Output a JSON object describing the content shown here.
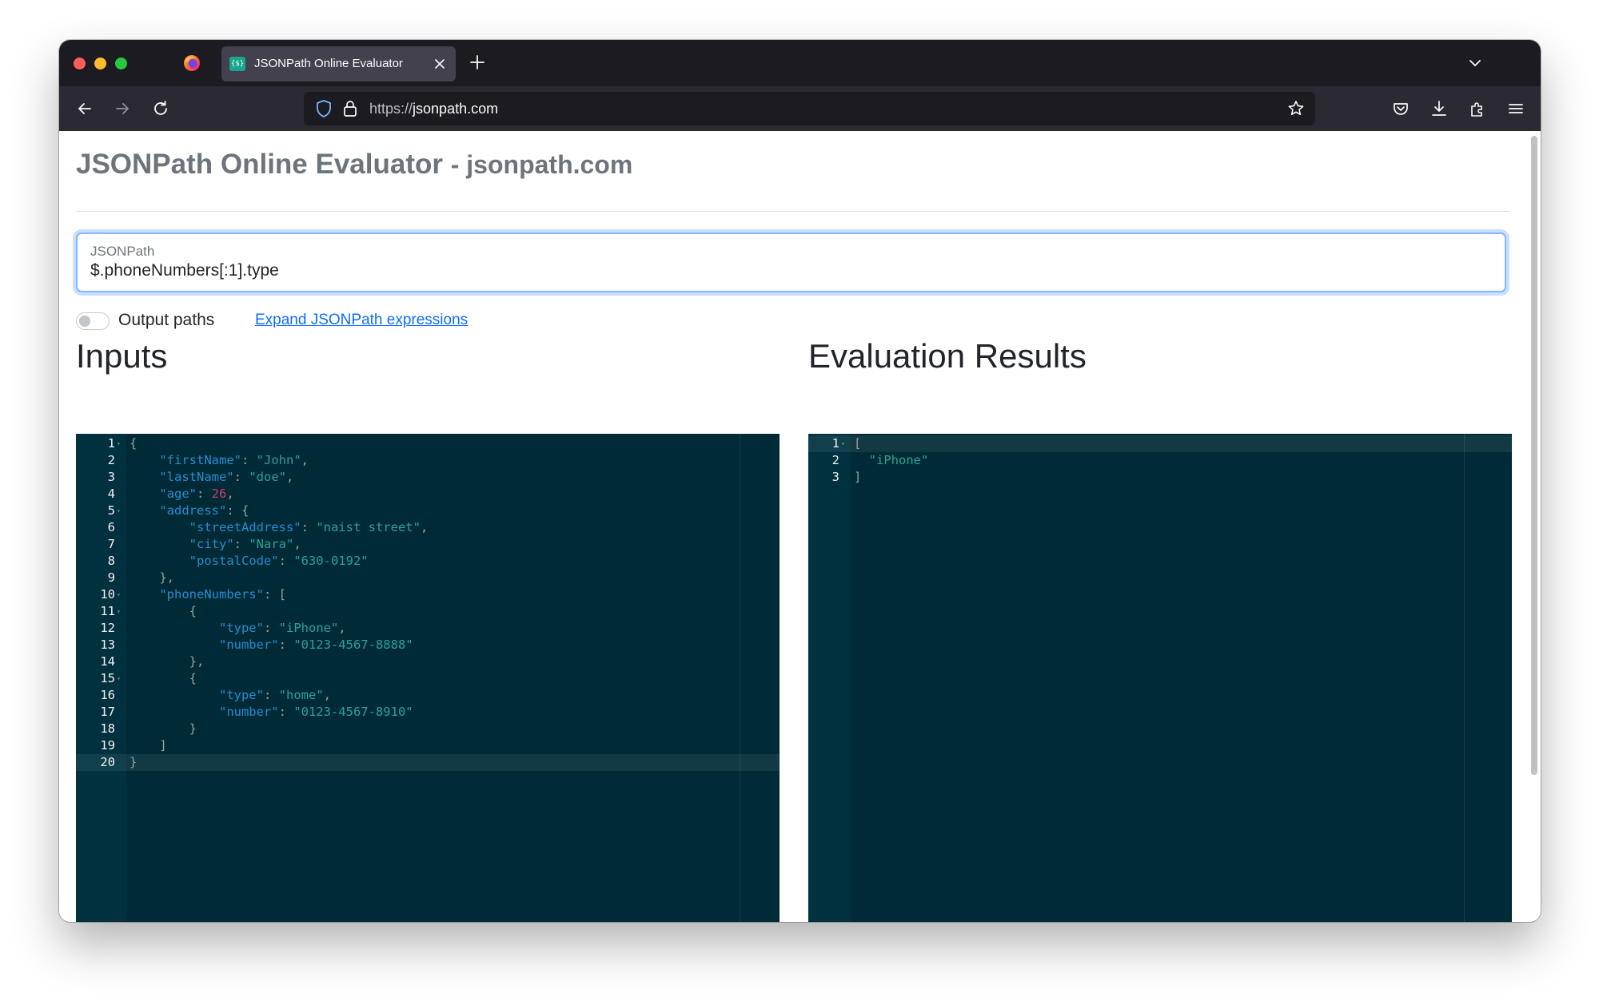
{
  "browser": {
    "tab_title": "JSONPath Online Evaluator",
    "favicon_text": "{$}",
    "url_scheme": "https://",
    "url_host": "jsonpath.com"
  },
  "page": {
    "title_main": "JSONPath Online Evaluator",
    "title_sub": "- jsonpath.com",
    "jsonpath_label": "JSONPath",
    "jsonpath_value": "$.phoneNumbers[:1].type",
    "output_paths_label": "Output paths",
    "output_paths_enabled": false,
    "expand_link": "Expand JSONPath expressions",
    "inputs_heading": "Inputs",
    "results_heading": "Evaluation Results"
  },
  "colors": {
    "editor_bg": "#002b36",
    "json_key": "#268bd2",
    "json_string": "#2aa198",
    "json_number": "#d33682",
    "link": "#0d6efd",
    "focus_border": "#86b7fe"
  },
  "input_editor": {
    "active_line": 20,
    "fold_lines": [
      1,
      5,
      10,
      11,
      15
    ],
    "lines": [
      [
        [
          "p",
          "{"
        ]
      ],
      [
        [
          "p",
          "    "
        ],
        [
          "k",
          "\"firstName\""
        ],
        [
          "p",
          ": "
        ],
        [
          "s",
          "\"John\""
        ],
        [
          "p",
          ","
        ]
      ],
      [
        [
          "p",
          "    "
        ],
        [
          "k",
          "\"lastName\""
        ],
        [
          "p",
          ": "
        ],
        [
          "s",
          "\"doe\""
        ],
        [
          "p",
          ","
        ]
      ],
      [
        [
          "p",
          "    "
        ],
        [
          "k",
          "\"age\""
        ],
        [
          "p",
          ": "
        ],
        [
          "n",
          "26"
        ],
        [
          "p",
          ","
        ]
      ],
      [
        [
          "p",
          "    "
        ],
        [
          "k",
          "\"address\""
        ],
        [
          "p",
          ": {"
        ]
      ],
      [
        [
          "p",
          "        "
        ],
        [
          "k",
          "\"streetAddress\""
        ],
        [
          "p",
          ": "
        ],
        [
          "s",
          "\"naist street\""
        ],
        [
          "p",
          ","
        ]
      ],
      [
        [
          "p",
          "        "
        ],
        [
          "k",
          "\"city\""
        ],
        [
          "p",
          ": "
        ],
        [
          "s",
          "\"Nara\""
        ],
        [
          "p",
          ","
        ]
      ],
      [
        [
          "p",
          "        "
        ],
        [
          "k",
          "\"postalCode\""
        ],
        [
          "p",
          ": "
        ],
        [
          "s",
          "\"630-0192\""
        ]
      ],
      [
        [
          "p",
          "    },"
        ]
      ],
      [
        [
          "p",
          "    "
        ],
        [
          "k",
          "\"phoneNumbers\""
        ],
        [
          "p",
          ": ["
        ]
      ],
      [
        [
          "p",
          "        {"
        ]
      ],
      [
        [
          "p",
          "            "
        ],
        [
          "k",
          "\"type\""
        ],
        [
          "p",
          ": "
        ],
        [
          "s",
          "\"iPhone\""
        ],
        [
          "p",
          ","
        ]
      ],
      [
        [
          "p",
          "            "
        ],
        [
          "k",
          "\"number\""
        ],
        [
          "p",
          ": "
        ],
        [
          "s",
          "\"0123-4567-8888\""
        ]
      ],
      [
        [
          "p",
          "        },"
        ]
      ],
      [
        [
          "p",
          "        {"
        ]
      ],
      [
        [
          "p",
          "            "
        ],
        [
          "k",
          "\"type\""
        ],
        [
          "p",
          ": "
        ],
        [
          "s",
          "\"home\""
        ],
        [
          "p",
          ","
        ]
      ],
      [
        [
          "p",
          "            "
        ],
        [
          "k",
          "\"number\""
        ],
        [
          "p",
          ": "
        ],
        [
          "s",
          "\"0123-4567-8910\""
        ]
      ],
      [
        [
          "p",
          "        }"
        ]
      ],
      [
        [
          "p",
          "    ]"
        ]
      ],
      [
        [
          "p",
          "}"
        ]
      ]
    ]
  },
  "result_editor": {
    "active_line": 1,
    "fold_lines": [
      1
    ],
    "lines": [
      [
        [
          "p",
          "["
        ]
      ],
      [
        [
          "p",
          "  "
        ],
        [
          "s",
          "\"iPhone\""
        ]
      ],
      [
        [
          "p",
          "]"
        ]
      ]
    ]
  }
}
